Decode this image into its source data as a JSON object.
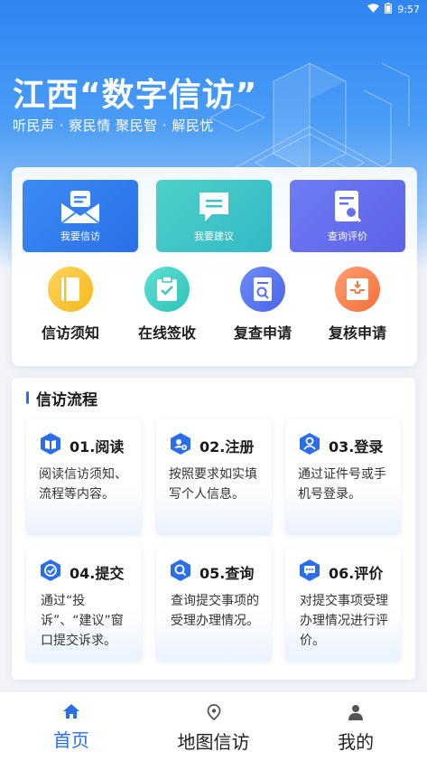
{
  "status_bar": {
    "time": "9:57"
  },
  "hero": {
    "title": "江西“数字信访”",
    "subtitle": "听民声 · 察民情 聚民智 · 解民忧"
  },
  "quick_actions": [
    {
      "label": "我要信访",
      "icon": "mail-icon",
      "color": "#3c8cf5"
    },
    {
      "label": "我要建议",
      "icon": "chat-icon",
      "color": "#40c4c6"
    },
    {
      "label": "查询评价",
      "icon": "search-doc-icon",
      "color": "#6570ef"
    }
  ],
  "round_actions": [
    {
      "label": "信访须知",
      "icon": "book-icon",
      "color": "#f5bf2e"
    },
    {
      "label": "在线签收",
      "icon": "clipboard-check-icon",
      "color": "#3cc8bd"
    },
    {
      "label": "复查申请",
      "icon": "doc-search-icon",
      "color": "#5570ee"
    },
    {
      "label": "复核申请",
      "icon": "inbox-icon",
      "color": "#f77a47"
    }
  ],
  "flow": {
    "title": "信访流程",
    "steps": [
      {
        "title": "01.阅读",
        "desc": "阅读信访须知、流程等内容。",
        "icon": "book-open-icon"
      },
      {
        "title": "02.注册",
        "desc": "按照要求如实填写个人信息。",
        "icon": "user-add-icon"
      },
      {
        "title": "03.登录",
        "desc": "通过证件号或手机号登录。",
        "icon": "user-icon"
      },
      {
        "title": "04.提交",
        "desc": "通过“投诉”、“建议”窗口提交诉求。",
        "icon": "check-shield-icon"
      },
      {
        "title": "05.查询",
        "desc": "查询提交事项的受理办理情况。",
        "icon": "search-icon"
      },
      {
        "title": "06.评价",
        "desc": "对提交事项受理办理情况进行评价。",
        "icon": "comment-icon"
      }
    ]
  },
  "tabbar": [
    {
      "label": "首页",
      "icon": "home-icon",
      "active": true
    },
    {
      "label": "地图信访",
      "icon": "location-icon",
      "active": false
    },
    {
      "label": "我的",
      "icon": "person-icon",
      "active": false
    }
  ],
  "colors": {
    "accent": "#2a6fe8",
    "hero": "#2f86f3"
  }
}
